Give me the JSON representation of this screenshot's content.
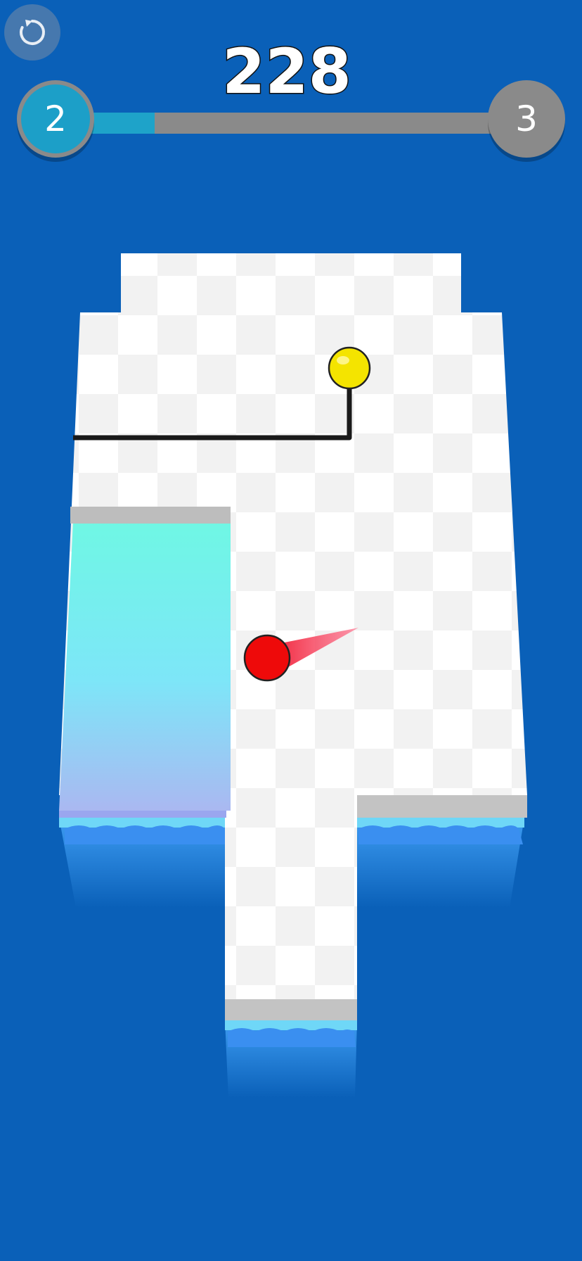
{
  "hud": {
    "score": "228",
    "current_level": "2",
    "next_level": "3",
    "progress": 0.18,
    "restart_icon": "restart-icon"
  },
  "colors": {
    "background": "#0a60b8",
    "floor_light": "#ffffff",
    "floor_dark": "#f1f1f1",
    "floor_edge": "#bdbdbd",
    "filled_paint_top": "#6cf5e6",
    "filled_paint_bottom": "#a9b8f2",
    "water_edge": "#6fd7f7",
    "ball_player": "#ee0a0a",
    "ball_goal": "#f4e400",
    "trail": "#1a1a1a",
    "progress_fill": "#1ea3c9",
    "progress_track": "#8a8a8a"
  }
}
